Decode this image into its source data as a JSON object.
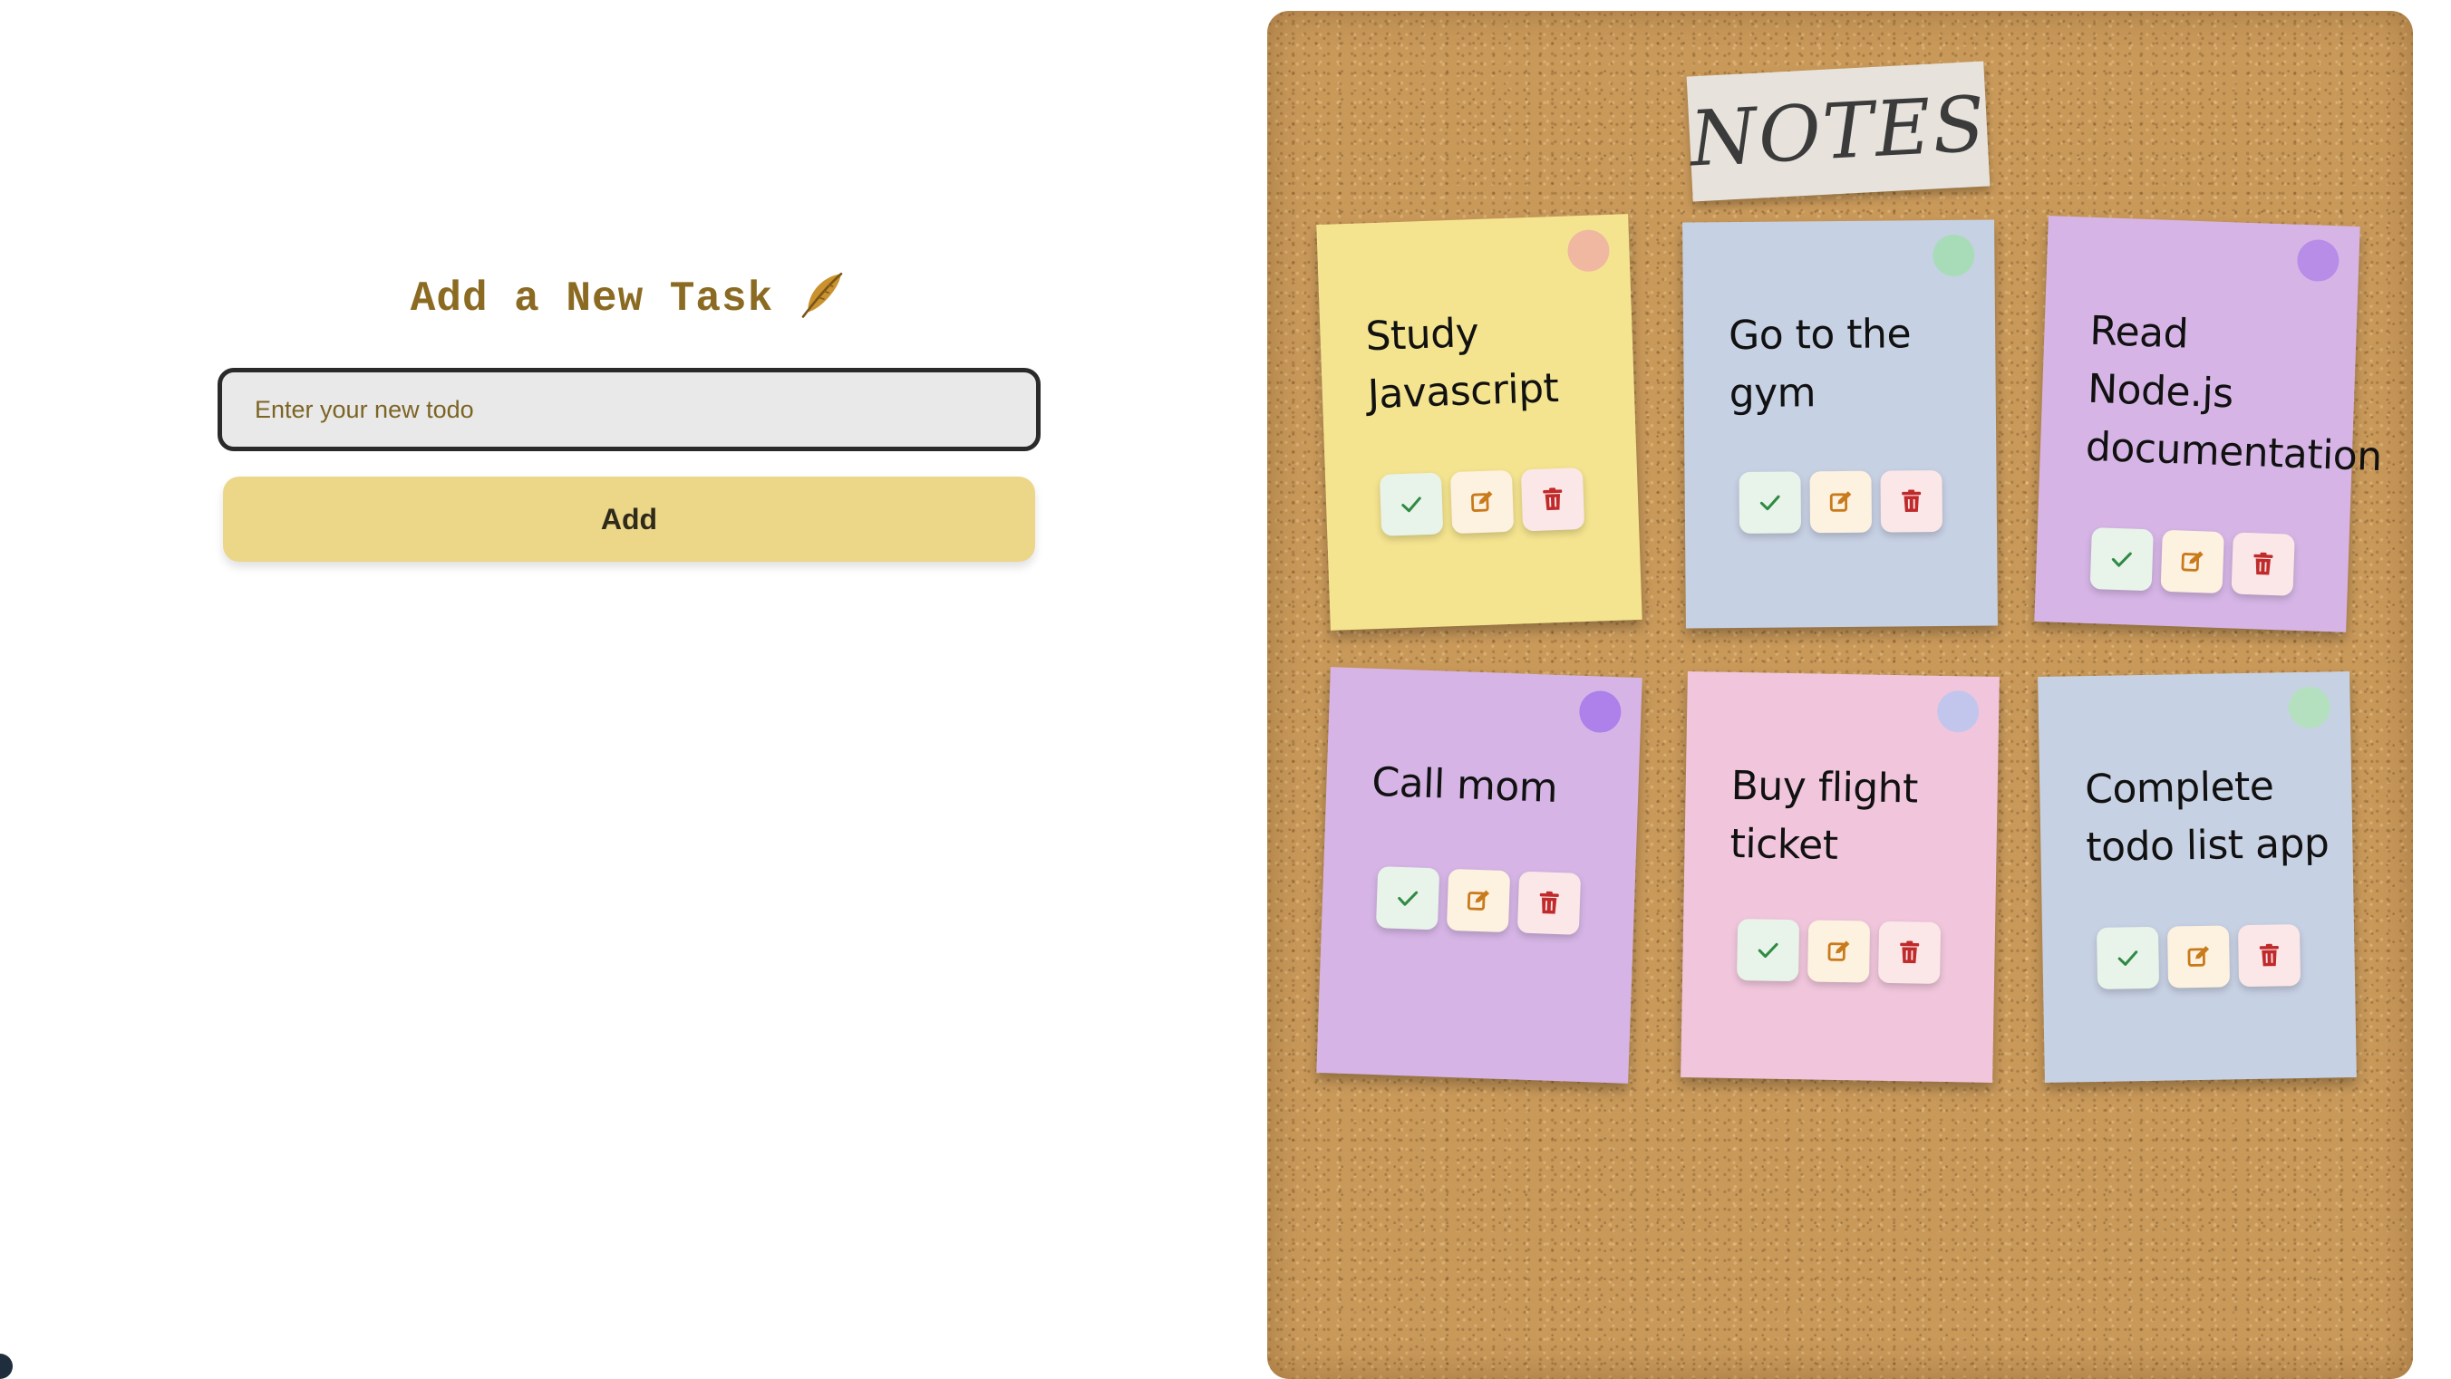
{
  "form": {
    "title": "Add a New Task",
    "title_icon": "feather-icon",
    "input_placeholder": "Enter your new todo",
    "input_value": "",
    "add_label": "Add"
  },
  "board": {
    "title": "NOTES"
  },
  "notes": [
    {
      "text": "Study Javascript",
      "color": "#f4e48f",
      "pin_color": "#f0b8a0"
    },
    {
      "text": "Go to the gym",
      "color": "#c7d1e4",
      "pin_color": "#a8dcb8"
    },
    {
      "text": "Read Node.js documentation",
      "color": "#d6b5e6",
      "pin_color": "#b78de8"
    },
    {
      "text": "Call mom",
      "color": "#d6b5e6",
      "pin_color": "#ad80ea"
    },
    {
      "text": "Buy flight ticket",
      "color": "#f1c6dc",
      "pin_color": "#c3c6ec"
    },
    {
      "text": "Complete todo list app",
      "color": "#c7d1e4",
      "pin_color": "#b5e0c0"
    }
  ],
  "note_actions": {
    "done_icon": "check-icon",
    "edit_icon": "edit-icon",
    "delete_icon": "trash-icon"
  },
  "colors": {
    "accent": "#8b6a22",
    "add_button": "#ecd688",
    "done_icon": "#2f8a43",
    "edit_icon": "#c97a1a",
    "delete_icon": "#c02a2a"
  }
}
